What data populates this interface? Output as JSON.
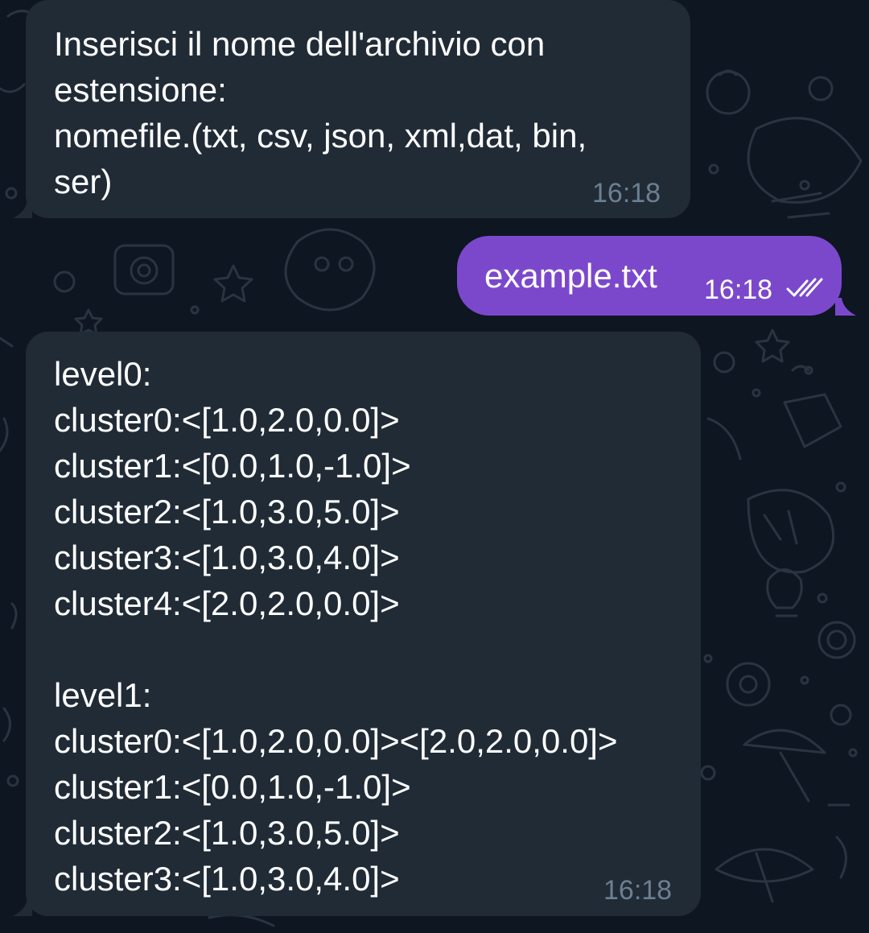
{
  "chat": {
    "messages": [
      {
        "direction": "incoming",
        "lines": [
          "Inserisci il nome dell'archivio con",
          "estensione:",
          "nomefile.(txt, csv, json, xml,dat, bin,",
          "ser)"
        ],
        "time": "16:18"
      },
      {
        "direction": "outgoing",
        "text": "example.txt",
        "time": "16:18",
        "status_icon": "double-check-icon"
      },
      {
        "direction": "incoming",
        "lines": [
          "level0:",
          "cluster0:<[1.0,2.0,0.0]>",
          "cluster1:<[0.0,1.0,-1.0]>",
          "cluster2:<[1.0,3.0,5.0]>",
          "cluster3:<[1.0,3.0,4.0]>",
          "cluster4:<[2.0,2.0,0.0]>",
          "",
          "level1:",
          "cluster0:<[1.0,2.0,0.0]><[2.0,2.0,0.0]>",
          "cluster1:<[0.0,1.0,-1.0]>",
          "cluster2:<[1.0,3.0,5.0]>",
          "cluster3:<[1.0,3.0,4.0]>"
        ],
        "time": "16:18"
      }
    ]
  },
  "colors": {
    "background": "#0e1621",
    "incoming_bubble": "#202b36",
    "outgoing_bubble": "#7b48cc",
    "incoming_time": "#6d7f91",
    "outgoing_time": "#ffffff"
  }
}
